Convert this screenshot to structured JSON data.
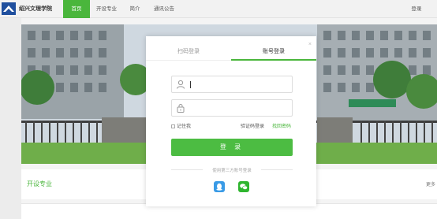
{
  "header": {
    "school_name": "绍兴文理学院",
    "nav": [
      "首页",
      "开设专业",
      "简介",
      "通讯公告"
    ],
    "login_link": "登录",
    "active_color": "#4ab63c"
  },
  "section": {
    "title": "开设专业",
    "more": "更多"
  },
  "login_modal": {
    "tabs": [
      "扫码登录",
      "账号登录"
    ],
    "active_tab": "账号登录",
    "username_value": "",
    "password_value": "",
    "remember_label": "记住我",
    "code_login_label": "验证码登录",
    "find_password_label": "找回密码",
    "submit_label": "登 录",
    "third_party_label": "使用第三方账号登录",
    "close_symbol": "×",
    "icons": [
      "user-icon",
      "lock-icon",
      "qq-icon",
      "wechat-icon"
    ]
  }
}
